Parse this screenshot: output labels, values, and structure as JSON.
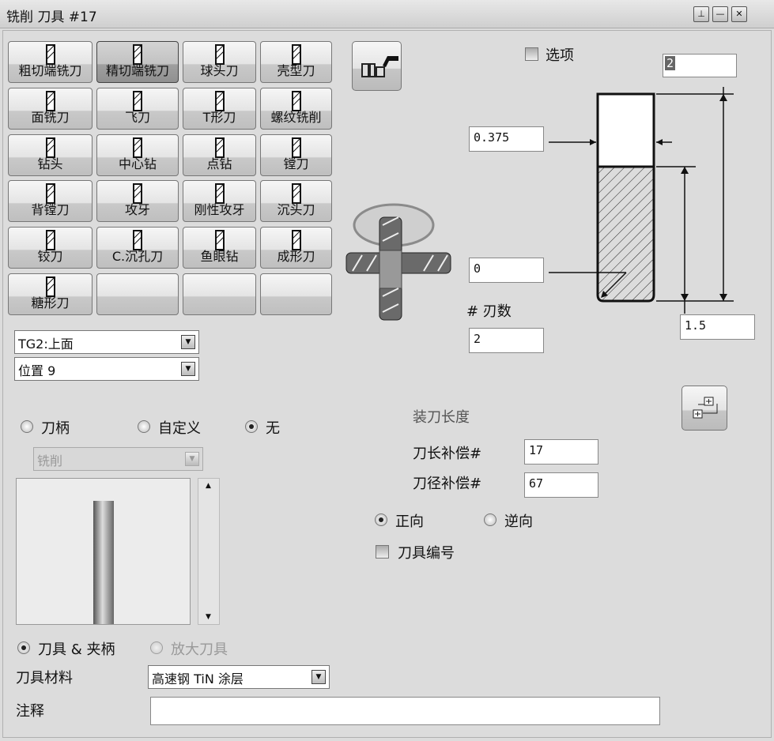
{
  "window": {
    "title": "铣削 刀具 #17",
    "buttons": [
      "pin",
      "minimize",
      "close"
    ]
  },
  "tool_types": [
    "粗切端铣刀",
    "精切端铣刀",
    "球头刀",
    "壳型刀",
    "面铣刀",
    "飞刀",
    "T形刀",
    "螺纹铣削",
    "钻头",
    "中心钻",
    "点钻",
    "镗刀",
    "背镗刀",
    "攻牙",
    "刚性攻牙",
    "沉头刀",
    "铰刀",
    "C.沉孔刀",
    "鱼眼钻",
    "成形刀",
    "糖形刀",
    "",
    "",
    ""
  ],
  "selected_tool_index": 1,
  "plane_select": "TG2:上面",
  "position_select": "位置 9",
  "options_label": "选项",
  "fields": {
    "overall_length": "2",
    "diameter": "0.375",
    "corner_radius": "0",
    "flutes_label": "# 刃数",
    "flutes": "2",
    "flute_length": "1.5"
  },
  "holder": {
    "options": [
      "刀柄",
      "自定义",
      "无"
    ],
    "selected": 2,
    "holder_type": "铣削"
  },
  "display": {
    "options": [
      "刀具 & 夹柄",
      "放大刀具"
    ],
    "selected": 0
  },
  "material_label": "刀具材料",
  "material": "高速钢 TiN 涂层",
  "comment_label": "注释",
  "comment": "",
  "mount": {
    "title": "装刀长度",
    "length_comp_label": "刀长补偿#",
    "length_comp": "17",
    "dia_comp_label": "刀径补偿#",
    "dia_comp": "67"
  },
  "direction": {
    "options": [
      "正向",
      "逆向"
    ],
    "selected": 0
  },
  "tool_number_label": "刀具编号"
}
